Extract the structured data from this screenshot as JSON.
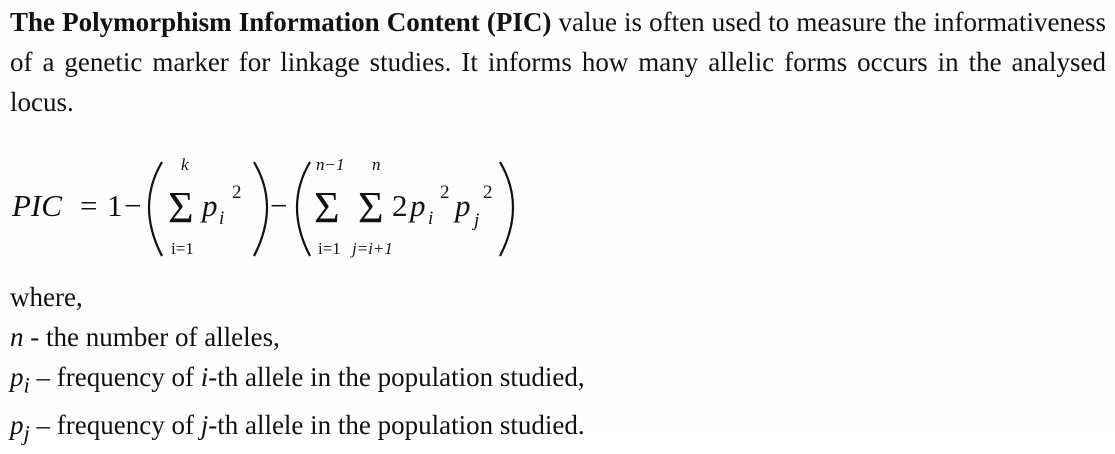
{
  "paragraph": {
    "bold_lead": "The Polymorphism Information Content (PIC)",
    "rest": " value is often used to measure the informativeness of a genetic marker for linkage studies. It informs how many allelic forms occurs in the analysed locus."
  },
  "formula": {
    "lhs": "PIC",
    "eq": "=",
    "one": "1",
    "minus": "−",
    "sigma": "Σ",
    "p": "p",
    "i_sub": "i",
    "j_sub": "j",
    "two_exp": "2",
    "two_coef": "2",
    "sum1_upper": "k",
    "sum1_lower": "i=1",
    "sum2_upper": "n−1",
    "sum2_lower": "i=1",
    "sum3_upper": "n",
    "sum3_lower": "j=i+1"
  },
  "definitions": {
    "where": "where,",
    "n_symbol": "n",
    "n_text": " - the number of alleles,",
    "pi_symbol": "p",
    "pi_sub": "i",
    "pi_text_a": " – frequency of ",
    "pi_ital": "i",
    "pi_text_b": "-th allele in the population studied,",
    "pj_symbol": "p",
    "pj_sub": "j",
    "pj_text_a": " – frequency of ",
    "pj_ital": "j",
    "pj_text_b": "-th allele in the population studied."
  }
}
